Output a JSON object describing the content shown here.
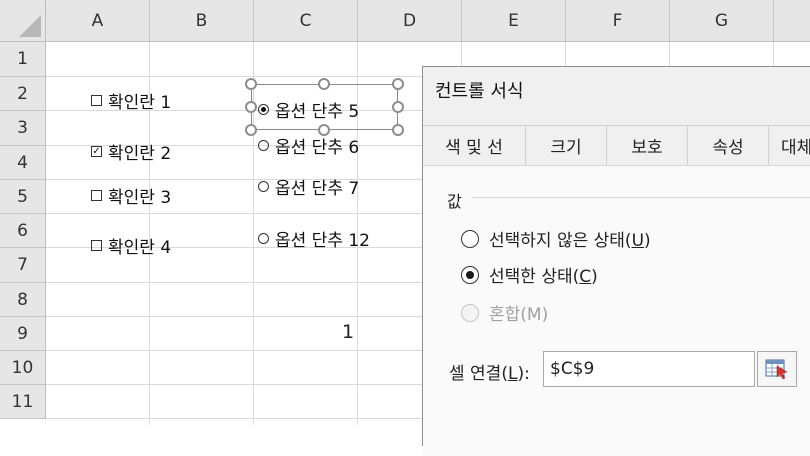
{
  "sheet": {
    "columns": [
      "A",
      "B",
      "C",
      "D",
      "E",
      "F",
      "G"
    ],
    "rows": [
      "1",
      "2",
      "3",
      "4",
      "5",
      "6",
      "7",
      "8",
      "9",
      "10",
      "11"
    ],
    "checkboxes": [
      {
        "label": "확인란 1",
        "checked": false,
        "mark": ""
      },
      {
        "label": "확인란 2",
        "checked": true,
        "mark": "✓"
      },
      {
        "label": "확인란 3",
        "checked": false,
        "mark": ""
      },
      {
        "label": "확인란 4",
        "checked": false,
        "mark": ""
      }
    ],
    "option_buttons": [
      {
        "label": "옵션 단추 5",
        "selected": true
      },
      {
        "label": "옵션 단추 6",
        "selected": false
      },
      {
        "label": "옵션 단추 7",
        "selected": false
      },
      {
        "label": "옵션 단추 12",
        "selected": false
      }
    ],
    "cell_c9_value": "1"
  },
  "dialog": {
    "title": "컨트롤 서식",
    "tabs": [
      "색 및 선",
      "크기",
      "보호",
      "속성",
      "대체"
    ],
    "active_tab": "컨트롤",
    "value_group_label": "값",
    "options": {
      "unchecked": {
        "label": "선택하지 않은 상태(",
        "key": "U",
        "tail": ")"
      },
      "checked": {
        "label": "선택한 상태(",
        "key": "C",
        "tail": ")"
      },
      "mixed": {
        "label": "혼합(M)"
      }
    },
    "cell_link": {
      "label": "셀 연결(",
      "key": "L",
      "tail": "):",
      "value": "$C$9"
    },
    "ref_button_icon": "range-select-icon"
  }
}
